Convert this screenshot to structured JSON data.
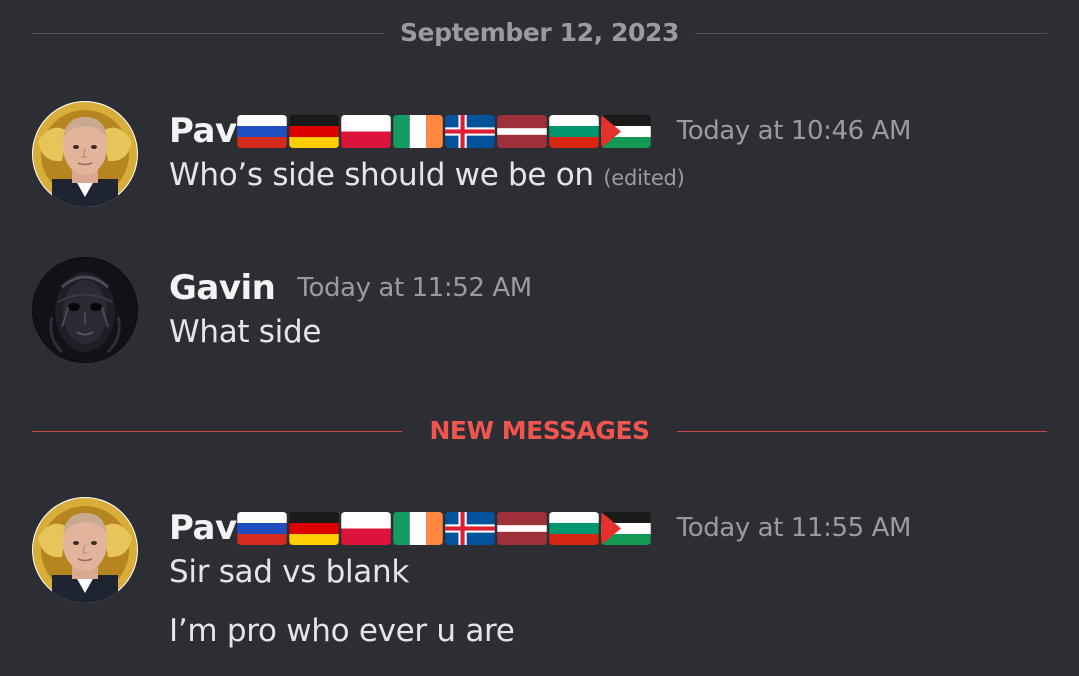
{
  "date_divider": "September 12, 2023",
  "new_messages_divider": "NEW MESSAGES",
  "messages": [
    {
      "author": "Pav",
      "author_flags": [
        "russia-flag-icon",
        "germany-flag-icon",
        "poland-flag-icon",
        "ireland-flag-icon",
        "iceland-flag-icon",
        "latvia-flag-icon",
        "bulgaria-flag-icon",
        "palestine-flag-icon"
      ],
      "timestamp": "Today at 10:46 AM",
      "lines": [
        "Who’s  side should we be on"
      ],
      "edited_label": "(edited)"
    },
    {
      "author": "Gavin",
      "timestamp": "Today at 11:52 AM",
      "lines": [
        "What side"
      ]
    },
    {
      "author": "Pav",
      "author_flags": [
        "russia-flag-icon",
        "germany-flag-icon",
        "poland-flag-icon",
        "ireland-flag-icon",
        "iceland-flag-icon",
        "latvia-flag-icon",
        "bulgaria-flag-icon",
        "palestine-flag-icon"
      ],
      "timestamp": "Today at 11:55 AM",
      "lines": [
        "Sir sad vs blank",
        "I’m pro who ever u are"
      ]
    }
  ],
  "colors": {
    "background": "#2d2e33",
    "new_messages_accent": "#f0564f",
    "muted_text": "#9a9ba2",
    "message_text": "#e4e5e8"
  }
}
